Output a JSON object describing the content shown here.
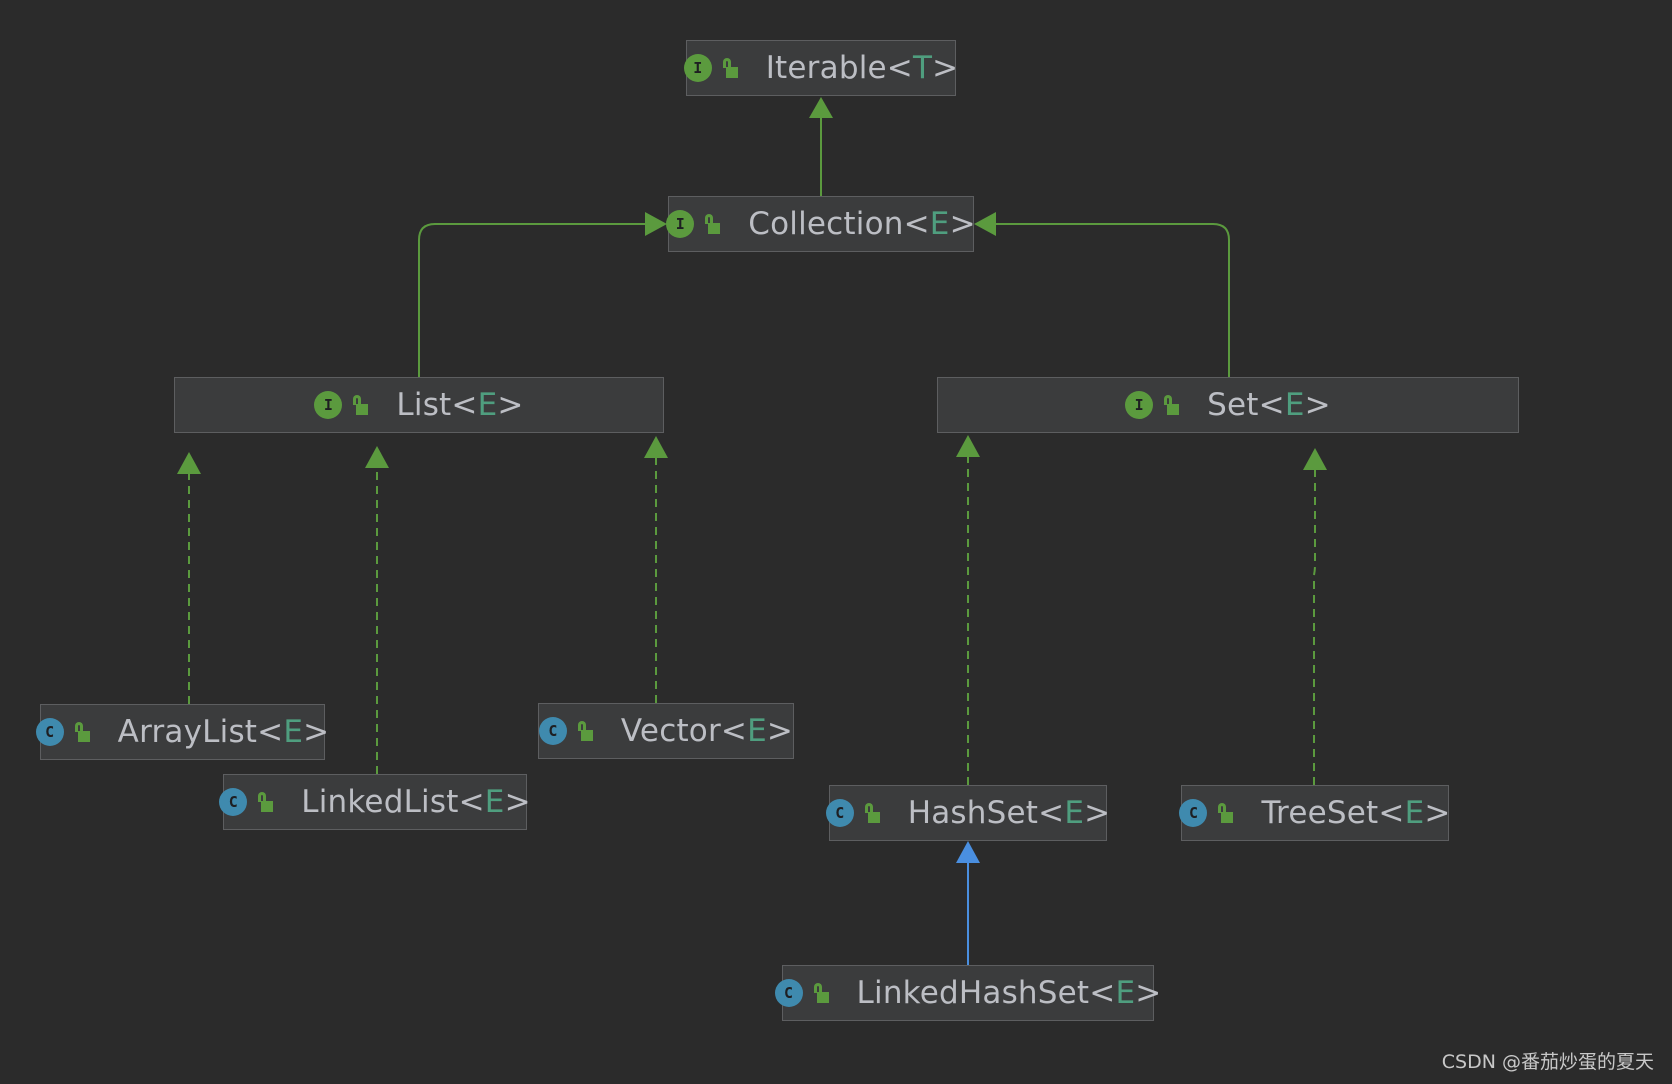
{
  "nodes": {
    "iterable": {
      "kind": "I",
      "name": "Iterable",
      "open": "<",
      "param": "T",
      "close": ">"
    },
    "collection": {
      "kind": "I",
      "name": "Collection",
      "open": "<",
      "param": "E",
      "close": ">"
    },
    "list": {
      "kind": "I",
      "name": "List",
      "open": "<",
      "param": "E",
      "close": ">"
    },
    "set": {
      "kind": "I",
      "name": "Set",
      "open": "<",
      "param": "E",
      "close": ">"
    },
    "arraylist": {
      "kind": "C",
      "name": "ArrayList",
      "open": "<",
      "param": "E",
      "close": ">"
    },
    "linkedlist": {
      "kind": "C",
      "name": "LinkedList",
      "open": "<",
      "param": "E",
      "close": ">"
    },
    "vector": {
      "kind": "C",
      "name": "Vector",
      "open": "<",
      "param": "E",
      "close": ">"
    },
    "hashset": {
      "kind": "C",
      "name": "HashSet",
      "open": "<",
      "param": "E",
      "close": ">"
    },
    "treeset": {
      "kind": "C",
      "name": "TreeSet",
      "open": "<",
      "param": "E",
      "close": ">"
    },
    "linkedhashset": {
      "kind": "C",
      "name": "LinkedHashSet",
      "open": "<",
      "param": "E",
      "close": ">"
    }
  },
  "edges": [
    {
      "from": "collection",
      "to": "iterable",
      "type": "extends"
    },
    {
      "from": "list",
      "to": "collection",
      "type": "extends"
    },
    {
      "from": "set",
      "to": "collection",
      "type": "extends"
    },
    {
      "from": "arraylist",
      "to": "list",
      "type": "implements"
    },
    {
      "from": "linkedlist",
      "to": "list",
      "type": "implements"
    },
    {
      "from": "vector",
      "to": "list",
      "type": "implements"
    },
    {
      "from": "hashset",
      "to": "set",
      "type": "implements"
    },
    {
      "from": "treeset",
      "to": "set",
      "type": "implements"
    },
    {
      "from": "linkedhashset",
      "to": "hashset",
      "type": "class-extends"
    }
  ],
  "colors": {
    "background": "#2b2b2b",
    "node_fill": "#3b3c3d",
    "node_border": "#5d5e60",
    "text": "#bcbec4",
    "type_param": "#4f9e7f",
    "interface_badge": "#5b9a3e",
    "class_badge": "#3f8aae",
    "edge_green": "#5b9a3e",
    "edge_blue": "#4a8fe0"
  },
  "watermark": "CSDN @番茄炒蛋的夏天"
}
